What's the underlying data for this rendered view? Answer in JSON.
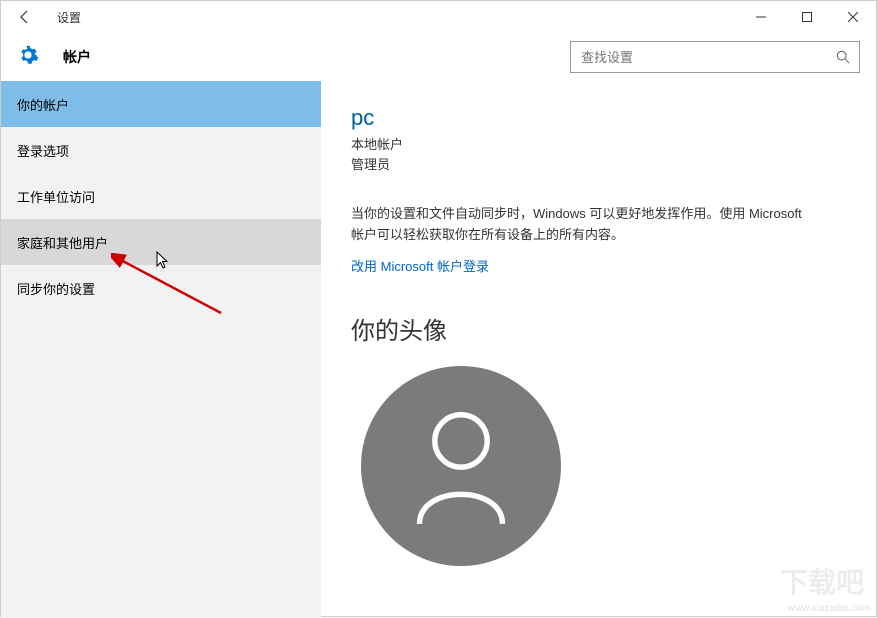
{
  "window": {
    "title": "设置"
  },
  "header": {
    "title": "帐户",
    "search_placeholder": "查找设置"
  },
  "sidebar": {
    "items": [
      {
        "label": "你的帐户",
        "selected": true
      },
      {
        "label": "登录选项"
      },
      {
        "label": "工作单位访问"
      },
      {
        "label": "家庭和其他用户",
        "hover": true
      },
      {
        "label": "同步你的设置"
      }
    ]
  },
  "content": {
    "username": "pc",
    "account_type": "本地帐户",
    "role": "管理员",
    "sync_message": "当你的设置和文件自动同步时，Windows 可以更好地发挥作用。使用 Microsoft 帐户可以轻松获取你在所有设备上的所有内容。",
    "ms_account_link": "改用 Microsoft 帐户登录",
    "avatar_heading": "你的头像"
  },
  "watermark": {
    "text": "www.xiazaiba.com"
  }
}
